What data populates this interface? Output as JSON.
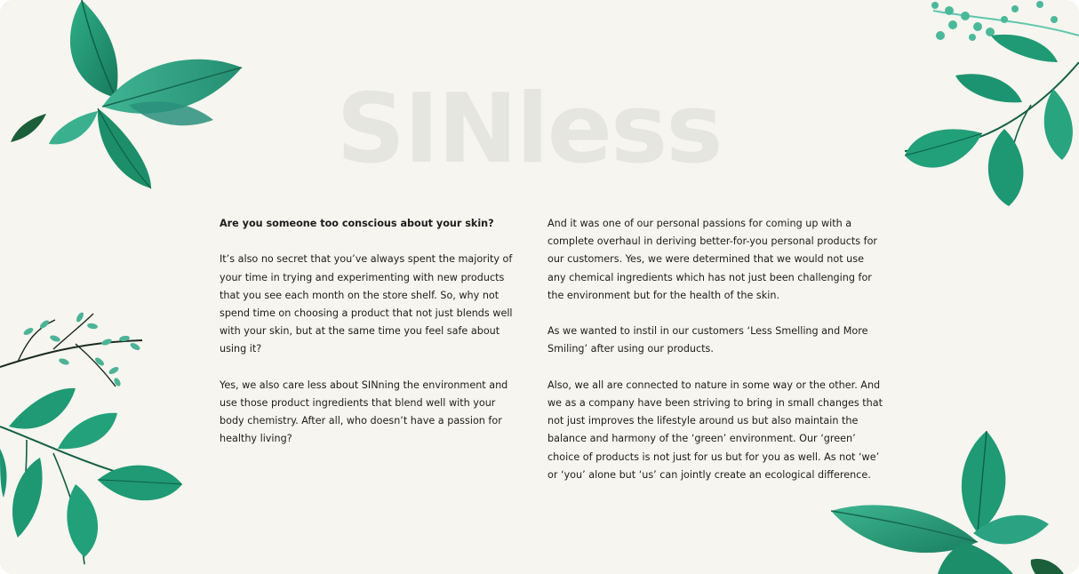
{
  "brand": {
    "name": "SINless"
  },
  "content": {
    "left": {
      "heading": "Are you someone too conscious about your skin?",
      "para1": "It’s also no secret that you’ve always spent the majority of your time in trying and experimenting with new products that you see each month on the store shelf. So, why not spend time on choosing a product that not just blends well with your skin, but at the same time you feel safe about using it?",
      "para2": "Yes, we also care less about SINning the environment and use those product ingredients that blend well with your body chemistry. After all, who doesn’t have a passion for healthy living?"
    },
    "right": {
      "para1": "And it was one of our personal passions for coming up with a complete overhaul in deriving better-for-you personal products for our customers. Yes, we were determined that we would not use any chemical ingredients which has not just been challenging for the environment but for the health of the skin.",
      "para2": "As we wanted to instil in our customers ‘Less Smelling and More Smiling’ after using our products.",
      "para3": "Also, we all are connected to nature in some way or the other. And we as a company have been striving to bring in small changes that not just improves the lifestyle around us but also maintain the balance and harmony of the ‘green’ environment. Our ‘green’ choice of products is not just for us but for you as well. As not ‘we’ or ‘you’ alone but ‘us’ can jointly create an ecological difference."
    }
  },
  "colors": {
    "background": "#f6f5ef",
    "leaf_dark": "#1c8c6c",
    "leaf_mid": "#23a17b",
    "leaf_light": "#4bbf9c",
    "leaf_shadow": "#176a52",
    "brand_watermark": "#e6e6e1"
  },
  "icons": {
    "top_left": "mint-leaves-illustration",
    "top_right": "eucalyptus-branch-illustration",
    "bottom_left": "eucalyptus-branch-illustration",
    "bottom_right": "mint-leaves-illustration"
  }
}
